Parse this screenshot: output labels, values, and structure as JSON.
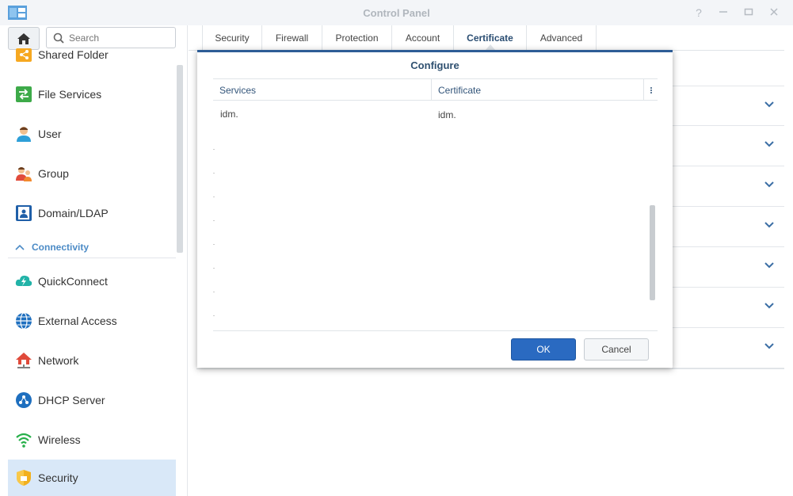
{
  "window": {
    "title": "Control Panel"
  },
  "search": {
    "placeholder": "Search"
  },
  "sidebar": {
    "items": [
      {
        "label": "Shared Folder",
        "icon": "shared-folder-icon"
      },
      {
        "label": "File Services",
        "icon": "file-services-icon"
      },
      {
        "label": "User",
        "icon": "user-icon"
      },
      {
        "label": "Group",
        "icon": "group-icon"
      },
      {
        "label": "Domain/LDAP",
        "icon": "domain-ldap-icon"
      }
    ],
    "section": {
      "label": "Connectivity"
    },
    "conn_items": [
      {
        "label": "QuickConnect",
        "icon": "quickconnect-icon"
      },
      {
        "label": "External Access",
        "icon": "external-access-icon"
      },
      {
        "label": "Network",
        "icon": "network-icon"
      },
      {
        "label": "DHCP Server",
        "icon": "dhcp-server-icon"
      },
      {
        "label": "Wireless",
        "icon": "wireless-icon"
      },
      {
        "label": "Security",
        "icon": "security-shield-icon"
      }
    ]
  },
  "tabs": [
    {
      "label": "Security"
    },
    {
      "label": "Firewall"
    },
    {
      "label": "Protection"
    },
    {
      "label": "Account"
    },
    {
      "label": "Certificate"
    },
    {
      "label": "Advanced"
    }
  ],
  "active_tab": "Certificate",
  "dialog": {
    "title": "Configure",
    "columns": [
      "Services",
      "Certificate"
    ],
    "rows": [
      {
        "service": "idm.",
        "certificate": "idm."
      }
    ],
    "ok_label": "OK",
    "cancel_label": "Cancel"
  },
  "colors": {
    "accent": "#2a6ac1",
    "active_sidebar": "#d9e8f8",
    "dialog_border": "#2d5d96",
    "section_header": "#4c8bc6"
  }
}
